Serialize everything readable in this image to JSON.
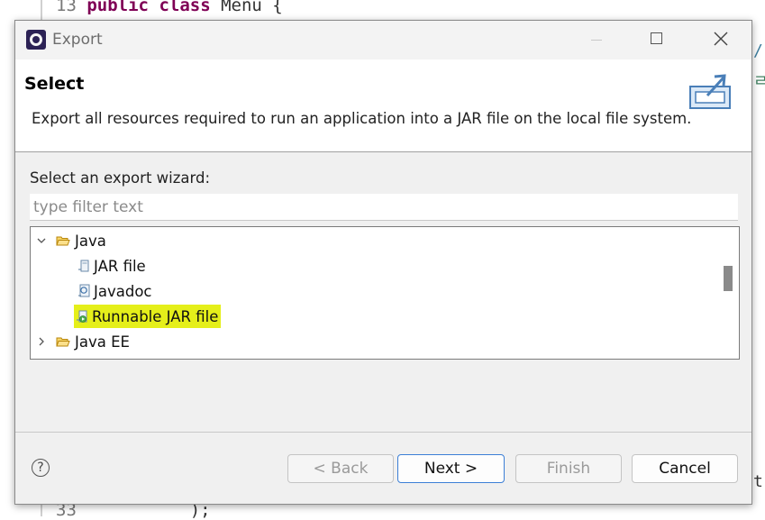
{
  "background_editor": {
    "top_line_number": "13",
    "top_keyword1": "public",
    "top_keyword2": "class",
    "top_text": "Menu {",
    "bottom_line_number": "33",
    "bottom_text": ");",
    "edge_fragment_1": "/",
    "edge_fragment_2": "ㄹ",
    "edge_fragment_3": "t."
  },
  "dialog": {
    "title": "Export",
    "header": {
      "title": "Select",
      "description": "Export all resources required to run an application into a JAR file on the local file system."
    },
    "wizard_label": "Select an export wizard:",
    "filter": {
      "value": "",
      "placeholder": "type filter text"
    },
    "tree": {
      "java": {
        "label": "Java",
        "expanded": true,
        "children": [
          "JAR file",
          "Javadoc",
          "Runnable JAR file"
        ],
        "selected": "Runnable JAR file"
      },
      "java_ee": {
        "label": "Java EE",
        "expanded": false
      }
    },
    "buttons": {
      "back": "< Back",
      "next": "Next >",
      "finish": "Finish",
      "cancel": "Cancel"
    },
    "help_label": "?"
  },
  "icons": {
    "app": "eclipse-icon",
    "minimize": "minimize-icon",
    "maximize": "maximize-icon",
    "close": "close-icon",
    "export": "export-wizard-icon",
    "folder": "folder-icon",
    "jar": "jar-file-icon",
    "javadoc": "javadoc-icon",
    "runnable_jar": "runnable-jar-icon",
    "help": "help-icon"
  },
  "colors": {
    "selection_highlight": "#e5ef1a",
    "default_button_border": "#3c7fd6",
    "keyword": "#7f0055"
  }
}
